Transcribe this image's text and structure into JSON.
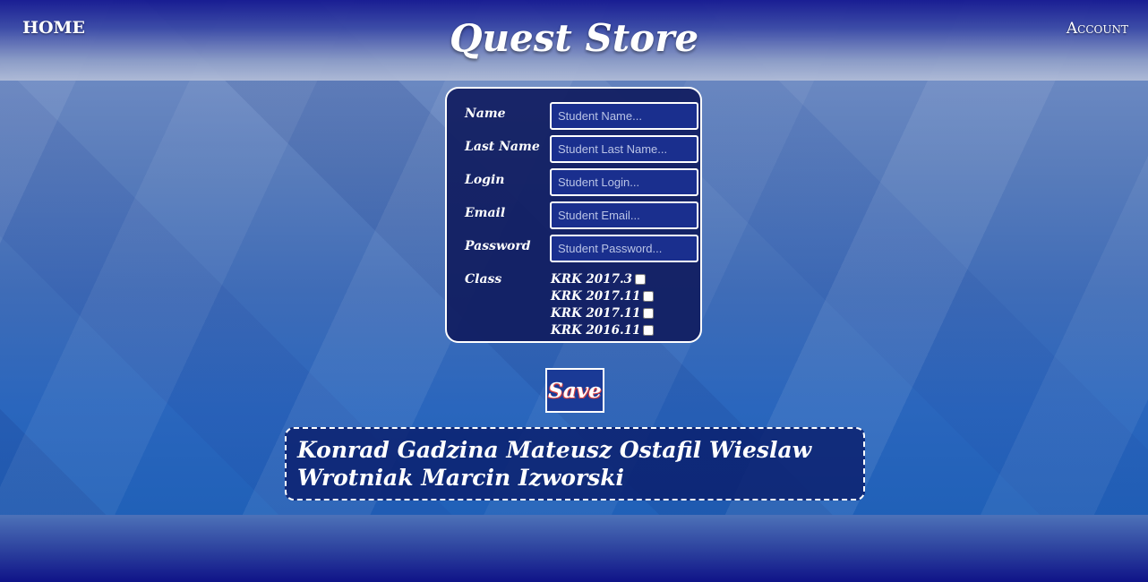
{
  "header": {
    "home_label": "HOME",
    "title": "Quest Store",
    "account_label": "Account"
  },
  "form": {
    "fields": [
      {
        "label": "Name",
        "placeholder": "Student Name...",
        "value": ""
      },
      {
        "label": "Last Name",
        "placeholder": "Student Last Name...",
        "value": ""
      },
      {
        "label": "Login",
        "placeholder": "Student Login...",
        "value": ""
      },
      {
        "label": "Email",
        "placeholder": "Student Email...",
        "value": ""
      },
      {
        "label": "Password",
        "placeholder": "Student Password...",
        "value": ""
      }
    ],
    "class_label": "Class",
    "class_options": [
      {
        "label": "KRK 2017.3",
        "checked": false
      },
      {
        "label": "KRK 2017.11",
        "checked": false
      },
      {
        "label": "KRK 2017.11",
        "checked": false
      },
      {
        "label": "KRK 2016.11",
        "checked": false
      }
    ]
  },
  "save_label": "Save",
  "names_text": "Konrad Gadzina Mateusz Ostafil Wieslaw Wrotniak Marcin Izworski",
  "colors": {
    "panel_background": "#101c60",
    "input_background": "#1a2f8e",
    "border": "#ffffff",
    "save_text_shadow": "#d94040"
  }
}
